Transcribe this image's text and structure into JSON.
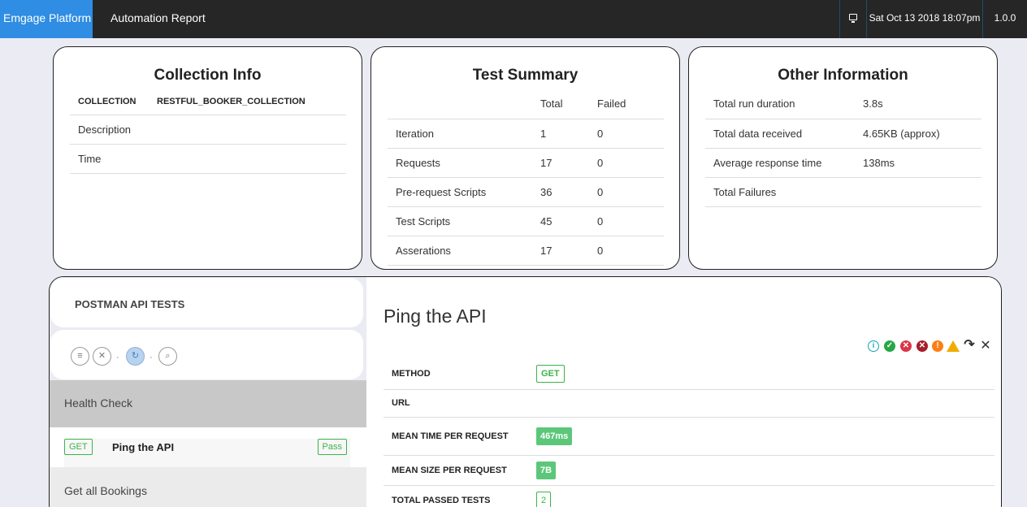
{
  "nav": {
    "brand": "Emgage Platform",
    "title": "Automation Report",
    "monitor_icon": "monitor-icon",
    "datetime": "Sat Oct 13 2018 18:07pm",
    "version": "1.0.0"
  },
  "collection_info": {
    "title": "Collection Info",
    "collection_label": "COLLECTION",
    "collection_value": "RESTFUL_BOOKER_COLLECTION",
    "description_label": "Description",
    "time_label": "Time"
  },
  "test_summary": {
    "title": "Test Summary",
    "col_total": "Total",
    "col_failed": "Failed",
    "rows": [
      {
        "label": "Iteration",
        "total": "1",
        "failed": "0"
      },
      {
        "label": "Requests",
        "total": "17",
        "failed": "0"
      },
      {
        "label": "Pre-request Scripts",
        "total": "36",
        "failed": "0"
      },
      {
        "label": "Test Scripts",
        "total": "45",
        "failed": "0"
      },
      {
        "label": "Asserations",
        "total": "17",
        "failed": "0"
      }
    ]
  },
  "other_info": {
    "title": "Other Information",
    "rows": [
      {
        "label": "Total run duration",
        "value": "3.8s"
      },
      {
        "label": "Total data received",
        "value": "4.65KB (approx)"
      },
      {
        "label": "Average response time",
        "value": "138ms"
      },
      {
        "label": "Total Failures",
        "value": ""
      }
    ]
  },
  "sidebar": {
    "heading": "POSTMAN API TESTS",
    "tools": {
      "list": "≡",
      "clear": "✕",
      "refresh": "↻",
      "search": "⌕",
      "sep": "·"
    },
    "folder_1": "Health Check",
    "request": {
      "method": "GET",
      "name": "Ping the API",
      "status": "Pass"
    },
    "folder_2": "Get all Bookings"
  },
  "detail": {
    "title": "Ping the API",
    "icons": {
      "info": "i",
      "check": "✓",
      "x1": "✕",
      "x2": "✕",
      "excl": "!",
      "redo": "↷",
      "close": "✕"
    },
    "method_label": "METHOD",
    "method_value": "GET",
    "url_label": "URL",
    "url_value": "",
    "mean_time_label": "MEAN TIME PER REQUEST",
    "mean_time_value": "467ms",
    "mean_size_label": "MEAN SIZE PER REQUEST",
    "mean_size_value": "7B",
    "passed_label": "TOTAL PASSED TESTS",
    "passed_value": "2"
  },
  "colors": {
    "brand": "#2f8de4",
    "pass_green": "#3bb44a",
    "badge_fill": "#5cc77a"
  }
}
